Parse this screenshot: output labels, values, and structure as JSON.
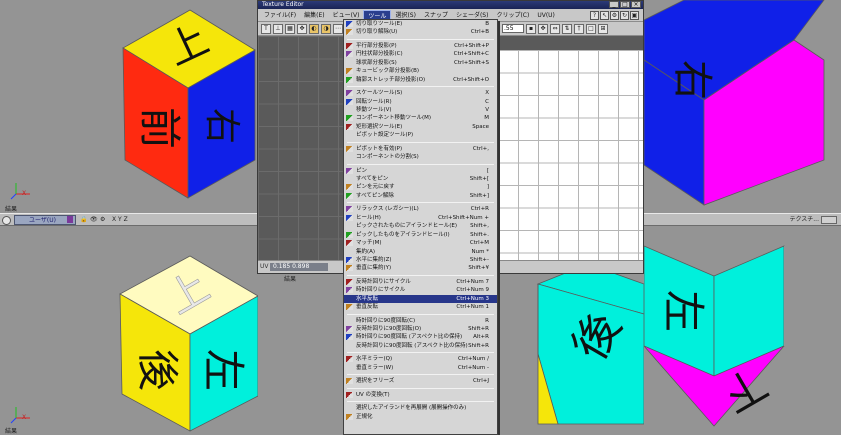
{
  "texture_editor": {
    "title": "Texture Editor",
    "menus": [
      "ファイル(F)",
      "編集(E)",
      "ビュー(V)",
      "ツール",
      "選択(S)",
      "スナップ",
      "シェーダ(S)",
      "クリップ(C)",
      "UV(U)"
    ],
    "active_menu_index": 3,
    "window_buttons": [
      "_",
      "□",
      "×"
    ],
    "coords": "0.185   0.898",
    "toolbar_value": ".55"
  },
  "viewports": {
    "persp_label": "透視",
    "status_left": "結果",
    "status_mid": "結果",
    "axis_x": "X",
    "axis_y": "Y",
    "axis_z": "Z",
    "panel_dropdown": "ユーザ(U)",
    "panel_axes": "X Y Z",
    "panel_right": "テクスチ..."
  },
  "cube_glyphs": {
    "tl_top": "上",
    "tl_left": "前",
    "tl_right": "右",
    "tr_top": "右",
    "bl_top": "上",
    "bl_left": "後",
    "bl_right": "左",
    "br_left": "後",
    "br_right": "左",
    "br_bottom": "下"
  },
  "colors": {
    "red": "#ff2a10",
    "yellow": "#f5e60a",
    "blue": "#1020e8",
    "magenta": "#ff00ff",
    "cyan": "#00f0dc",
    "paleyellow": "#fffbc0",
    "menu_highlight": "#27368a"
  },
  "menu": {
    "items": [
      {
        "label": "切り取りツール(E)",
        "shortcut": "B"
      },
      {
        "label": "切り取り解除(U)",
        "shortcut": "Ctrl+B"
      },
      {
        "sep": true
      },
      {
        "label": "平行部分投影(P)",
        "shortcut": "Ctrl+Shift+P"
      },
      {
        "label": "円柱状部分投影(C)",
        "shortcut": "Ctrl+Shift+C"
      },
      {
        "label": "球状部分投影(S)",
        "shortcut": "Ctrl+Shift+S"
      },
      {
        "label": "キュービック部分投影(B)",
        "shortcut": ""
      },
      {
        "label": "輪郭ストレッチ部分投影(O)",
        "shortcut": "Ctrl+Shift+O"
      },
      {
        "sep": true
      },
      {
        "label": "スケールツール(S)",
        "shortcut": "X"
      },
      {
        "label": "回転ツール(R)",
        "shortcut": "C"
      },
      {
        "label": "移動ツール(V)",
        "shortcut": "V"
      },
      {
        "label": "コンポーネント移動ツール(M)",
        "shortcut": "M"
      },
      {
        "label": "矩形選択ツール(E)",
        "shortcut": "Space"
      },
      {
        "label": "ピボット設定ツール(P)",
        "shortcut": ""
      },
      {
        "sep": true
      },
      {
        "label": "ピボットを有効(P)",
        "shortcut": "Ctrl+,"
      },
      {
        "label": "コンポーネントの分割(S)",
        "shortcut": ""
      },
      {
        "sep": true
      },
      {
        "label": "ピン",
        "shortcut": "["
      },
      {
        "label": "すべてをピン",
        "shortcut": "Shift+["
      },
      {
        "label": "ピンを元に戻す",
        "shortcut": "]"
      },
      {
        "label": "すべてピン解除",
        "shortcut": "Shift+]"
      },
      {
        "sep": true
      },
      {
        "label": "リラックス (レガシー)(L)",
        "shortcut": "Ctrl+R"
      },
      {
        "label": "ヒール(H)",
        "shortcut": "Ctrl+Shift+Num +"
      },
      {
        "label": "ピックされたものにアイランドヒール(E)",
        "shortcut": "Shift+,"
      },
      {
        "label": "ピックしたものをアイランドヒール(I)",
        "shortcut": "Shift+."
      },
      {
        "label": "マッチ(M)",
        "shortcut": "Ctrl+M"
      },
      {
        "label": "集約(A)",
        "shortcut": "Num *"
      },
      {
        "label": "水平に集約(Z)",
        "shortcut": "Shift+-"
      },
      {
        "label": "垂直に集約(Y)",
        "shortcut": "Shift+¥"
      },
      {
        "sep": true
      },
      {
        "label": "反時計回りにサイクル",
        "shortcut": "Ctrl+Num 7"
      },
      {
        "label": "時計回りにサイクル",
        "shortcut": "Ctrl+Num 9"
      },
      {
        "label": "水平反転",
        "shortcut": "Ctrl+Num 3",
        "selected": true
      },
      {
        "label": "垂直反転",
        "shortcut": "Ctrl+Num 1"
      },
      {
        "sep": true
      },
      {
        "label": "時計回りに90度回転(C)",
        "shortcut": "R"
      },
      {
        "label": "反時計回りに90度回転(O)",
        "shortcut": "Shift+R"
      },
      {
        "label": "時計回りに90度回転 (アスペクト比の保持)",
        "shortcut": "Alt+R"
      },
      {
        "label": "反時計回りに90度回転 (アスペクト比の保持)",
        "shortcut": "Shift+R"
      },
      {
        "sep": true
      },
      {
        "label": "水平ミラー(Q)",
        "shortcut": "Ctrl+Num /"
      },
      {
        "label": "垂直ミラー(W)",
        "shortcut": "Ctrl+Num -"
      },
      {
        "sep": true
      },
      {
        "label": "選択をフリーズ",
        "shortcut": "Ctrl+J"
      },
      {
        "sep": true
      },
      {
        "label": "UV の変換(T)",
        "shortcut": ""
      },
      {
        "sep": true
      },
      {
        "label": "選択したアイランドを再展開 (展開操作のみ)",
        "shortcut": ""
      },
      {
        "label": "正規化",
        "shortcut": ""
      }
    ]
  }
}
